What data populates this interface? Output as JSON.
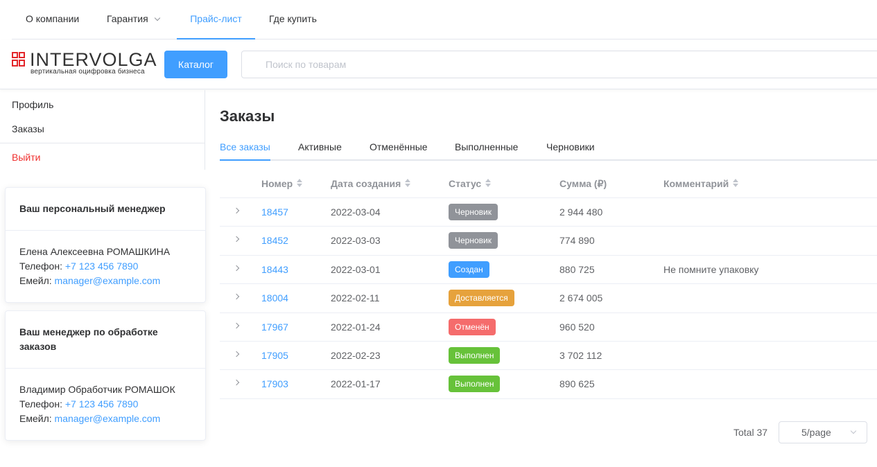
{
  "topnav": {
    "items": [
      {
        "label": "О компании"
      },
      {
        "label": "Гарантия"
      },
      {
        "label": "Прайс-лист"
      },
      {
        "label": "Где купить"
      }
    ]
  },
  "header": {
    "logo_text": "INTERVOLGA",
    "logo_sub": "вертикальная оцифровка бизнеса",
    "catalog_label": "Каталог",
    "search_placeholder": "Поиск по товарам",
    "brand_color": "#e3262a",
    "accent_color": "#409eff"
  },
  "sidebar": {
    "items": [
      {
        "label": "Профиль"
      },
      {
        "label": "Заказы"
      }
    ],
    "logout_label": "Выйти"
  },
  "cards": [
    {
      "title": "Ваш персональный менеджер",
      "name": "Елена Алексеевна РОМАШКИНА",
      "phone_label": "Телефон: ",
      "phone": "+7 123 456 7890",
      "email_label": "Емейл: ",
      "email": "manager@example.com"
    },
    {
      "title": "Ваш менеджер по обработке заказов",
      "name": "Владимир Обработчик РОМАШОК",
      "phone_label": "Телефон: ",
      "phone": "+7 123 456 7890",
      "email_label": "Емейл: ",
      "email": "manager@example.com"
    }
  ],
  "main": {
    "title": "Заказы",
    "tabs": [
      {
        "label": "Все заказы"
      },
      {
        "label": "Активные"
      },
      {
        "label": "Отменённые"
      },
      {
        "label": "Выполненные"
      },
      {
        "label": "Черновики"
      }
    ]
  },
  "table": {
    "columns": [
      "Номер",
      "Дата создания",
      "Статус",
      "Сумма (₽)",
      "Комментарий"
    ],
    "rows": [
      {
        "number": "18457",
        "date": "2022-03-04",
        "status": "Черновик",
        "status_color": "#909399",
        "sum": "2 944 480",
        "comment": ""
      },
      {
        "number": "18452",
        "date": "2022-03-03",
        "status": "Черновик",
        "status_color": "#909399",
        "sum": "774 890",
        "comment": ""
      },
      {
        "number": "18443",
        "date": "2022-03-01",
        "status": "Создан",
        "status_color": "#409eff",
        "sum": "880 725",
        "comment": "Не помните упаковку"
      },
      {
        "number": "18004",
        "date": "2022-02-11",
        "status": "Доставляется",
        "status_color": "#e6a23c",
        "sum": "2 674 005",
        "comment": ""
      },
      {
        "number": "17967",
        "date": "2022-01-24",
        "status": "Отменён",
        "status_color": "#f56c6c",
        "sum": "960 520",
        "comment": ""
      },
      {
        "number": "17905",
        "date": "2022-02-23",
        "status": "Выполнен",
        "status_color": "#67c23a",
        "sum": "3 702 112",
        "comment": ""
      },
      {
        "number": "17903",
        "date": "2022-01-17",
        "status": "Выполнен",
        "status_color": "#67c23a",
        "sum": "890 625",
        "comment": ""
      }
    ]
  },
  "pagination": {
    "total_label": "Total 37",
    "page_size_label": "5/page"
  }
}
